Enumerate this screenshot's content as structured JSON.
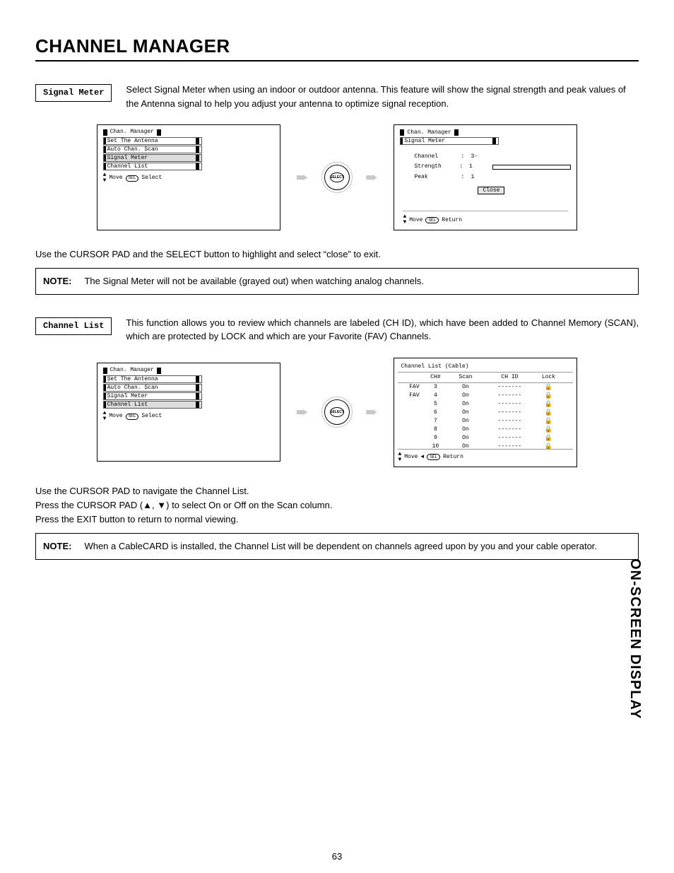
{
  "title": "CHANNEL MANAGER",
  "section1": {
    "label": "Signal Meter",
    "intro": "Select Signal Meter when using an indoor or outdoor antenna.  This feature will show the signal strength and peak values of the Antenna signal to help  you adjust your antenna to optimize signal reception.",
    "fig_left": {
      "header": "Chan. Manager",
      "items": [
        "Set The Antenna",
        "Auto Chan. Scan",
        "Signal Meter",
        "Channel List"
      ],
      "highlight_index": 2,
      "footer_move": "Move",
      "footer_sel_key": "SEL",
      "footer_sel": "Select"
    },
    "select_label": "SELECT",
    "fig_right": {
      "header": "Chan. Manager",
      "sub": "Signal Meter",
      "rows": [
        {
          "label": "Channel",
          "value": "3-"
        },
        {
          "label": "Strength",
          "value": "1"
        },
        {
          "label": "Peak",
          "value": "1"
        }
      ],
      "close": "Close",
      "footer_move": "Move",
      "footer_ret_key": "SEL",
      "footer_ret": "Return"
    },
    "after_para": "Use the CURSOR PAD and the SELECT button to highlight and select “close” to exit.",
    "note_label": "NOTE:",
    "note": "The Signal Meter will not be available (grayed out) when watching analog channels."
  },
  "section2": {
    "label": "Channel List",
    "intro": "This function allows you to review which channels are labeled (CH ID), which have been added to Channel Memory (SCAN), which are protected by LOCK and which are your Favorite (FAV) Channels.",
    "fig_left": {
      "header": "Chan. Manager",
      "items": [
        "Set The Antenna",
        "Auto Chan. Scan",
        "Signal Meter",
        "Channel List"
      ],
      "highlight_index": 3,
      "footer_move": "Move",
      "footer_sel_key": "SEL",
      "footer_sel": "Select"
    },
    "select_label": "SELECT",
    "fig_right": {
      "title": "Channel List (Cable)",
      "head": {
        "fav": "",
        "ch": "CH#",
        "scan": "Scan",
        "chid": "CH ID",
        "lock": "Lock"
      },
      "rows": [
        {
          "fav": "FAV",
          "ch": "3",
          "scan": "On",
          "chid": "-------"
        },
        {
          "fav": "FAV",
          "ch": "4",
          "scan": "On",
          "chid": "-------"
        },
        {
          "fav": "",
          "ch": "5",
          "scan": "On",
          "chid": "-------"
        },
        {
          "fav": "",
          "ch": "6",
          "scan": "On",
          "chid": "-------"
        },
        {
          "fav": "",
          "ch": "7",
          "scan": "On",
          "chid": "-------"
        },
        {
          "fav": "",
          "ch": "8",
          "scan": "On",
          "chid": "-------"
        },
        {
          "fav": "",
          "ch": "9",
          "scan": "On",
          "chid": "-------"
        },
        {
          "fav": "",
          "ch": "10",
          "scan": "On",
          "chid": "-------"
        }
      ],
      "footer_move": "Move",
      "footer_ret_key": "SEL",
      "footer_ret": "Return"
    },
    "after_paras": [
      "Use the CURSOR PAD to navigate the Channel List.",
      "Press the CURSOR PAD (▲, ▼) to select On or Off on the Scan column.",
      "Press the EXIT button to return to normal viewing."
    ],
    "note_label": "NOTE:",
    "note": "When a CableCARD is installed, the Channel List will be dependent on channels agreed upon by you and your cable operator."
  },
  "side_label": "ON-SCREEN DISPLAY",
  "page_number": "63"
}
